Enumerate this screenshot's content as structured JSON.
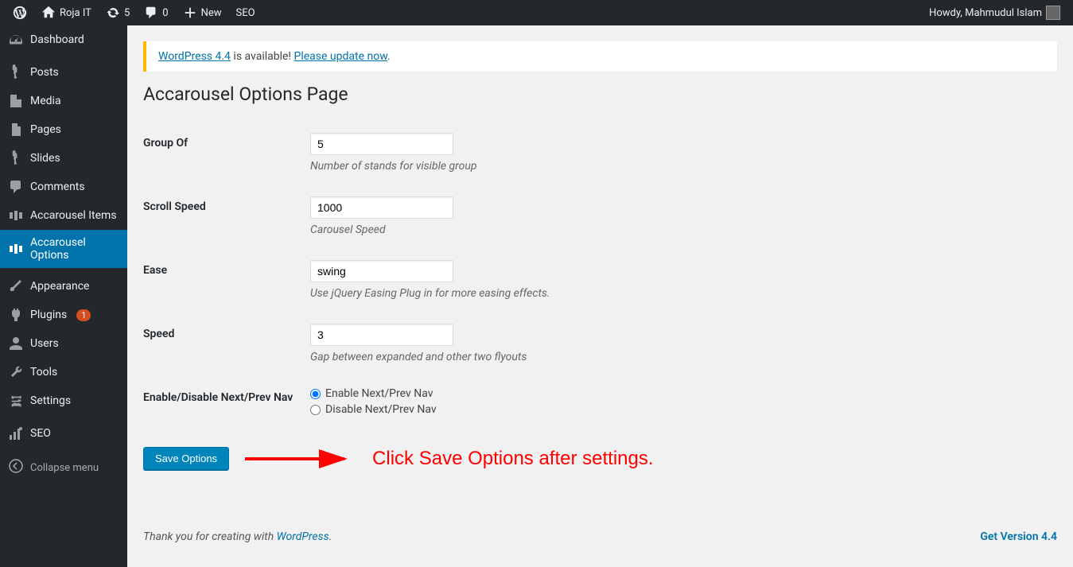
{
  "adminbar": {
    "site_name": "Roja IT",
    "updates_count": "5",
    "comments_count": "0",
    "new_label": "New",
    "seo_label": "SEO",
    "howdy": "Howdy, Mahmudul Islam"
  },
  "sidebar": {
    "items": [
      {
        "label": "Dashboard",
        "icon": "dashboard"
      },
      {
        "label": "Posts",
        "icon": "pin"
      },
      {
        "label": "Media",
        "icon": "media"
      },
      {
        "label": "Pages",
        "icon": "pages"
      },
      {
        "label": "Slides",
        "icon": "pin"
      },
      {
        "label": "Comments",
        "icon": "comments"
      },
      {
        "label": "Accarousel Items",
        "icon": "carousel"
      },
      {
        "label": "Accarousel Options",
        "icon": "carousel",
        "active": true
      },
      {
        "label": "Appearance",
        "icon": "brush"
      },
      {
        "label": "Plugins",
        "icon": "plug",
        "badge": "1"
      },
      {
        "label": "Users",
        "icon": "user"
      },
      {
        "label": "Tools",
        "icon": "wrench"
      },
      {
        "label": "Settings",
        "icon": "settings"
      },
      {
        "label": "SEO",
        "icon": "seo"
      }
    ],
    "collapse": "Collapse menu"
  },
  "notice": {
    "link1": "WordPress 4.4",
    "text": " is available! ",
    "link2": "Please update now",
    "dot": "."
  },
  "page_title": "Accarousel Options Page",
  "form": {
    "group_of": {
      "label": "Group Of",
      "value": "5",
      "desc": "Number of stands for visible group"
    },
    "scroll_speed": {
      "label": "Scroll Speed",
      "value": "1000",
      "desc": "Carousel Speed"
    },
    "ease": {
      "label": "Ease",
      "value": "swing",
      "desc": "Use jQuery Easing Plug in for more easing effects."
    },
    "speed": {
      "label": "Speed",
      "value": "3",
      "desc": "Gap between expanded and other two flyouts"
    },
    "nav": {
      "label": "Enable/Disable Next/Prev Nav",
      "enable": "Enable Next/Prev Nav",
      "disable": "Disable Next/Prev Nav",
      "selected": "enable"
    },
    "submit": "Save Options"
  },
  "annotation": "Click Save Options after settings.",
  "footer": {
    "text": "Thank you for creating with ",
    "link": "WordPress",
    "dot": ".",
    "right": "Get Version 4.4"
  }
}
